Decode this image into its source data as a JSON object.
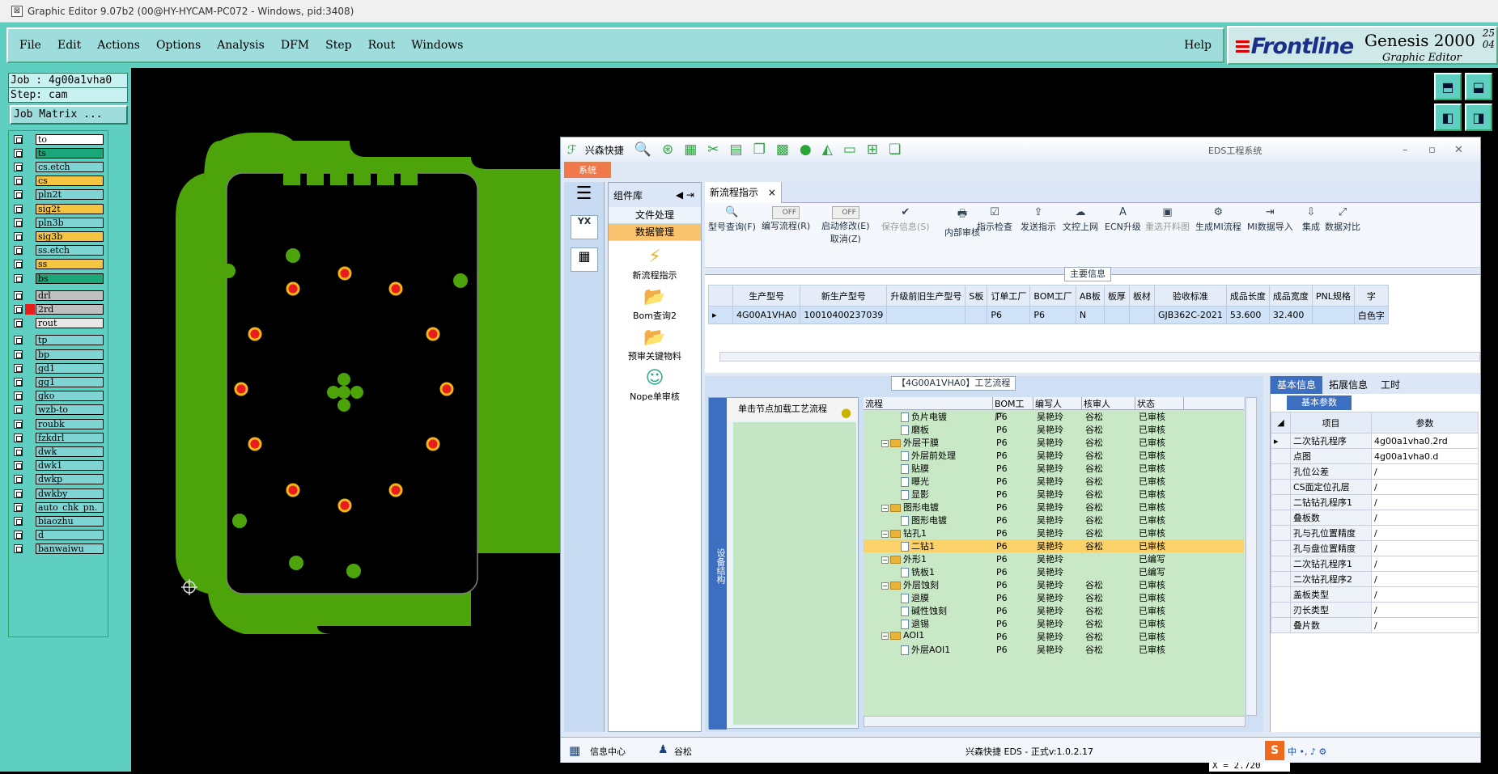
{
  "window": {
    "title": "Graphic Editor 9.07b2 (00@HY-HYCAM-PC072 - Windows, pid:3408)"
  },
  "menu": {
    "items": [
      "File",
      "Edit",
      "Actions",
      "Options",
      "Analysis",
      "DFM",
      "Step",
      "Rout",
      "Windows"
    ],
    "help": "Help"
  },
  "brand": {
    "logo": "Frontline",
    "product": "Genesis 2000",
    "sub": "Graphic Editor",
    "ver": "25",
    "ver2": "04"
  },
  "job": {
    "label": "Job : 4g00a1vha0",
    "step": "Step: cam",
    "matrix_btn": "Job Matrix ..."
  },
  "layers": [
    {
      "name": "to",
      "color": "#ffffff"
    },
    {
      "name": "ts",
      "color": "#1aa87a"
    },
    {
      "name": "cs.etch",
      "color": "#7fd4d4"
    },
    {
      "name": "cs",
      "color": "#f5c542"
    },
    {
      "name": "pln2t",
      "color": "#7fd4d4"
    },
    {
      "name": "sig2t",
      "color": "#f5c542"
    },
    {
      "name": "pln3b",
      "color": "#7fd4d4"
    },
    {
      "name": "sig3b",
      "color": "#f5c542"
    },
    {
      "name": "ss.etch",
      "color": "#7fd4d4"
    },
    {
      "name": "ss",
      "color": "#f5c542"
    },
    {
      "name": "bs",
      "color": "#1aa87a"
    },
    {
      "name": "drl",
      "color": "#c0c0c0"
    },
    {
      "name": "2rd",
      "color": "#c0c0c0"
    },
    {
      "name": "rout",
      "color": "#e8e8e8"
    },
    {
      "name": "tp",
      "color": "#7fd4d4"
    },
    {
      "name": "bp",
      "color": "#7fd4d4"
    },
    {
      "name": "gd1",
      "color": "#7fd4d4"
    },
    {
      "name": "gg1",
      "color": "#7fd4d4"
    },
    {
      "name": "gko",
      "color": "#7fd4d4"
    },
    {
      "name": "wzb-to",
      "color": "#7fd4d4"
    },
    {
      "name": "roubk",
      "color": "#7fd4d4"
    },
    {
      "name": "fzkdrl",
      "color": "#7fd4d4"
    },
    {
      "name": "dwk",
      "color": "#7fd4d4"
    },
    {
      "name": "dwk1",
      "color": "#7fd4d4"
    },
    {
      "name": "dwkp",
      "color": "#7fd4d4"
    },
    {
      "name": "dwkby",
      "color": "#7fd4d4"
    },
    {
      "name": "auto_chk_pn.",
      "color": "#7fd4d4"
    },
    {
      "name": "biaozhu",
      "color": "#7fd4d4"
    },
    {
      "name": "d",
      "color": "#7fd4d4"
    },
    {
      "name": "banwaiwu",
      "color": "#7fd4d4"
    }
  ],
  "eds": {
    "app": "兴森快捷",
    "title": "EDS工程系统",
    "systab": "系统",
    "complib": "组件库",
    "sections": [
      "文件处理",
      "数据管理"
    ],
    "libitems": [
      "新流程指示",
      "Bom查询2",
      "预审关键物料",
      "Nope单审核"
    ],
    "tab": "新流程指示",
    "ribbon": [
      {
        "label": "型号查询(F)",
        "icon": "🔍"
      },
      {
        "label": "编写流程(R)",
        "icon": "OFF"
      },
      {
        "label": "启动修改(E)",
        "label2": "取消(Z)",
        "icon": "OFF"
      },
      {
        "label": "保存信息(S)",
        "icon": "✔"
      },
      {
        "label": "内部审核",
        "icon": "🖶"
      },
      {
        "label": "指示检查",
        "icon": "☑"
      },
      {
        "label": "发送指示",
        "icon": "⇪"
      },
      {
        "label": "文控上网",
        "icon": "☁"
      },
      {
        "label": "ECN升级",
        "icon": "A"
      },
      {
        "label": "重选开料图",
        "icon": "▣"
      },
      {
        "label": "生成MI流程",
        "icon": "⚙"
      },
      {
        "label": "MI数据导入",
        "icon": "⇥"
      },
      {
        "label": "集成",
        "icon": "⇩"
      },
      {
        "label": "数据对比",
        "icon": "⤢"
      }
    ],
    "mainparams_title": "主要信息",
    "prod_headers": [
      "生产型号",
      "新生产型号",
      "升级前旧生产型号",
      "S板",
      "订单工厂",
      "BOM工厂",
      "AB板",
      "板厚",
      "板材",
      "验收标准",
      "成品长度",
      "成品宽度",
      "PNL规格",
      "字"
    ],
    "prod_row": [
      "4G00A1VHA0",
      "10010400237039",
      "",
      "",
      "P6",
      "P6",
      "N",
      "",
      "",
      "GJB362C-2021",
      "53.600",
      "32.400",
      "",
      "白色字"
    ],
    "process_title": "【4G00A1VHA0】工艺流程",
    "leftv_tab": "设备结构",
    "hint": "单击节点加载工艺流程",
    "tree_headers": [
      "流程",
      "BOM工厂",
      "编写人",
      "核审人",
      "状态"
    ],
    "tree": [
      {
        "indent": 2,
        "type": "doc",
        "name": "负片电镀",
        "bom": "P6",
        "w": "吴艳玲",
        "r": "谷松",
        "s": "已审核"
      },
      {
        "indent": 2,
        "type": "doc",
        "name": "磨板",
        "bom": "P6",
        "w": "吴艳玲",
        "r": "谷松",
        "s": "已审核"
      },
      {
        "indent": 1,
        "type": "fold",
        "name": "外层干膜",
        "bom": "P6",
        "w": "吴艳玲",
        "r": "谷松",
        "s": "已审核"
      },
      {
        "indent": 2,
        "type": "doc",
        "name": "外层前处理",
        "bom": "P6",
        "w": "吴艳玲",
        "r": "谷松",
        "s": "已审核"
      },
      {
        "indent": 2,
        "type": "doc",
        "name": "贴膜",
        "bom": "P6",
        "w": "吴艳玲",
        "r": "谷松",
        "s": "已审核"
      },
      {
        "indent": 2,
        "type": "doc",
        "name": "曝光",
        "bom": "P6",
        "w": "吴艳玲",
        "r": "谷松",
        "s": "已审核"
      },
      {
        "indent": 2,
        "type": "doc",
        "name": "显影",
        "bom": "P6",
        "w": "吴艳玲",
        "r": "谷松",
        "s": "已审核"
      },
      {
        "indent": 1,
        "type": "fold",
        "name": "图形电镀",
        "bom": "P6",
        "w": "吴艳玲",
        "r": "谷松",
        "s": "已审核"
      },
      {
        "indent": 2,
        "type": "doc",
        "name": "图形电镀",
        "bom": "P6",
        "w": "吴艳玲",
        "r": "谷松",
        "s": "已审核"
      },
      {
        "indent": 1,
        "type": "fold",
        "name": "钻孔1",
        "bom": "P6",
        "w": "吴艳玲",
        "r": "谷松",
        "s": "已审核"
      },
      {
        "indent": 2,
        "type": "doc",
        "name": "二钻1",
        "bom": "P6",
        "w": "吴艳玲",
        "r": "谷松",
        "s": "已审核",
        "sel": true
      },
      {
        "indent": 1,
        "type": "fold",
        "name": "外形1",
        "bom": "P6",
        "w": "吴艳玲",
        "r": "",
        "s": "已编写"
      },
      {
        "indent": 2,
        "type": "doc",
        "name": "铣板1",
        "bom": "P6",
        "w": "吴艳玲",
        "r": "",
        "s": "已编写"
      },
      {
        "indent": 1,
        "type": "fold",
        "name": "外层蚀刻",
        "bom": "P6",
        "w": "吴艳玲",
        "r": "谷松",
        "s": "已审核"
      },
      {
        "indent": 2,
        "type": "doc",
        "name": "退膜",
        "bom": "P6",
        "w": "吴艳玲",
        "r": "谷松",
        "s": "已审核"
      },
      {
        "indent": 2,
        "type": "doc",
        "name": "碱性蚀刻",
        "bom": "P6",
        "w": "吴艳玲",
        "r": "谷松",
        "s": "已审核"
      },
      {
        "indent": 2,
        "type": "doc",
        "name": "退锡",
        "bom": "P6",
        "w": "吴艳玲",
        "r": "谷松",
        "s": "已审核"
      },
      {
        "indent": 1,
        "type": "fold",
        "name": "AOI1",
        "bom": "P6",
        "w": "吴艳玲",
        "r": "谷松",
        "s": "已审核"
      },
      {
        "indent": 2,
        "type": "doc",
        "name": "外层AOI1",
        "bom": "P6",
        "w": "吴艳玲",
        "r": "谷松",
        "s": "已审核"
      }
    ],
    "rtabs": [
      "基本信息",
      "拓展信息",
      "工时"
    ],
    "subtab": "基本参数",
    "param_headers": [
      "项目",
      "参数"
    ],
    "params": [
      [
        "二次钻孔程序",
        "4g00a1vha0.2rd"
      ],
      [
        "点图",
        "4g00a1vha0.d"
      ],
      [
        "孔位公差",
        "/"
      ],
      [
        "CS面定位孔层",
        "/"
      ],
      [
        "二钻钻孔程序1",
        "/"
      ],
      [
        "叠板数",
        "/"
      ],
      [
        "孔与孔位置精度",
        "/"
      ],
      [
        "孔与盘位置精度",
        "/"
      ],
      [
        "二次钻孔程序1",
        "/"
      ],
      [
        "二次钻孔程序2",
        "/"
      ],
      [
        "盖板类型",
        "/"
      ],
      [
        "刃长类型",
        "/"
      ],
      [
        "叠片数",
        "/"
      ]
    ],
    "status": {
      "info": "信息中心",
      "user": "谷松",
      "version": "兴森快捷 EDS - 正式v:1.0.2.17"
    }
  },
  "coords": {
    "readout": "X = 2.720"
  }
}
